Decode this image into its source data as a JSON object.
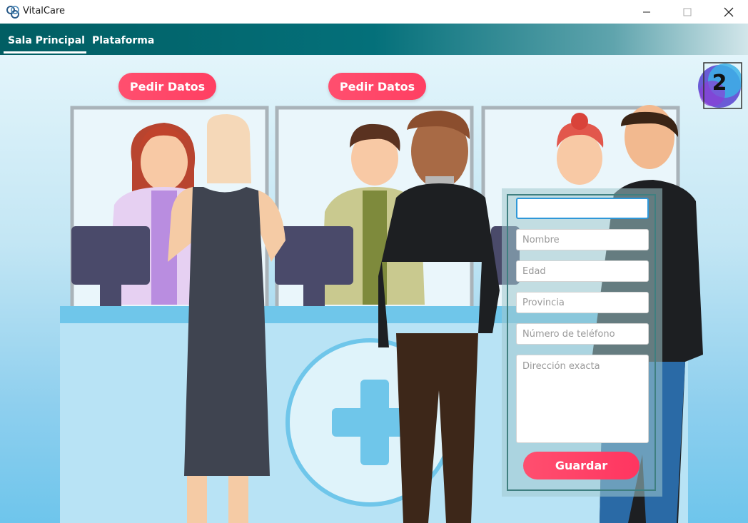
{
  "window": {
    "title": "VitalCare",
    "controls": {
      "minimize": "minimize-icon",
      "maximize": "maximize-icon",
      "close": "close-icon"
    }
  },
  "menu": {
    "tabs": [
      {
        "label": "Sala Principal",
        "active": true
      },
      {
        "label": "Plataforma",
        "active": false
      }
    ]
  },
  "scene": {
    "request_buttons": [
      "Pedir Datos",
      "Pedir Datos"
    ],
    "counter_badge": "2"
  },
  "form": {
    "fields": [
      {
        "value": "",
        "placeholder": ""
      },
      {
        "value": "",
        "placeholder": "Nombre"
      },
      {
        "value": "",
        "placeholder": "Edad"
      },
      {
        "value": "",
        "placeholder": "Provincia"
      },
      {
        "value": "",
        "placeholder": "Número de teléfono"
      }
    ],
    "address": {
      "value": "",
      "placeholder": "Dirección exacta"
    },
    "save_label": "Guardar"
  },
  "colors": {
    "accent": "#ff4d6d",
    "header": "#04707a",
    "background": "#c3e6f4"
  }
}
